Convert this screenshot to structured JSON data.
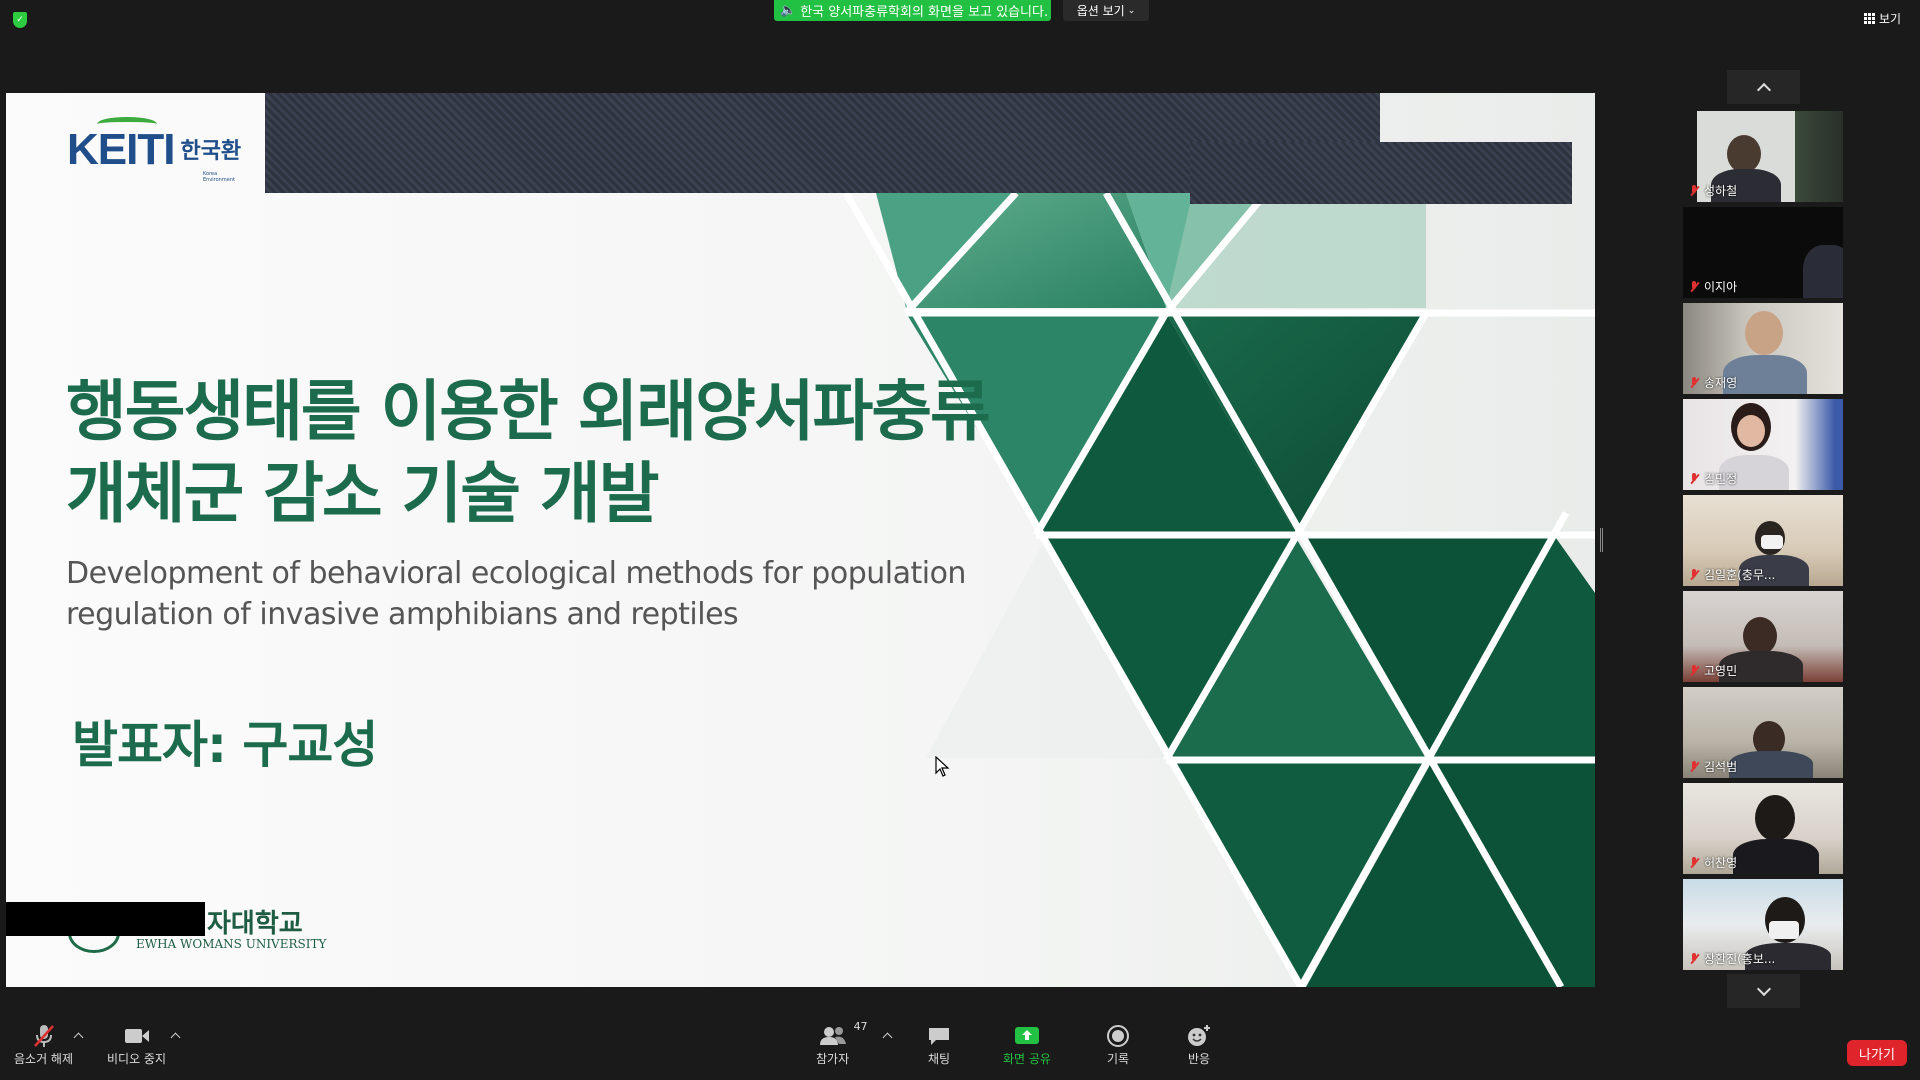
{
  "top": {
    "share_banner": "한국 양서파충류학회의 화면을 보고 있습니다.",
    "view_options": "옵션 보기",
    "view_button": "보기"
  },
  "slide": {
    "logo_text": "KEITI",
    "logo_korean": "한국환",
    "logo_sub": "Korea Environment",
    "title_line1": "행동생태를 이용한 외래양서파충류",
    "title_line2": "개체군 감소 기술 개발",
    "subtitle_line1": "Development of behavioral ecological methods for population",
    "subtitle_line2": "regulation of invasive amphibians and reptiles",
    "presenter": "발표자: 구교성",
    "university_korean": "자대학교",
    "university_english": "EWHA WOMANS UNIVERSITY"
  },
  "participants": [
    {
      "name": "성하철"
    },
    {
      "name": "이지아"
    },
    {
      "name": "송재영"
    },
    {
      "name": "김민정"
    },
    {
      "name": "김일훈(충무..."
    },
    {
      "name": "고영민"
    },
    {
      "name": "김석범"
    },
    {
      "name": "허찬영"
    },
    {
      "name": "장환진(홍보..."
    }
  ],
  "toolbar": {
    "unmute": "음소거 해제",
    "stop_video": "비디오 중지",
    "participants": "참가자",
    "participants_count": "47",
    "chat": "채팅",
    "share_screen": "화면 공유",
    "record": "기록",
    "reactions": "반응",
    "leave": "나가기"
  },
  "colors": {
    "share_green": "#23c143",
    "slide_green": "#1c6b4d",
    "leave_red": "#e0242c"
  }
}
